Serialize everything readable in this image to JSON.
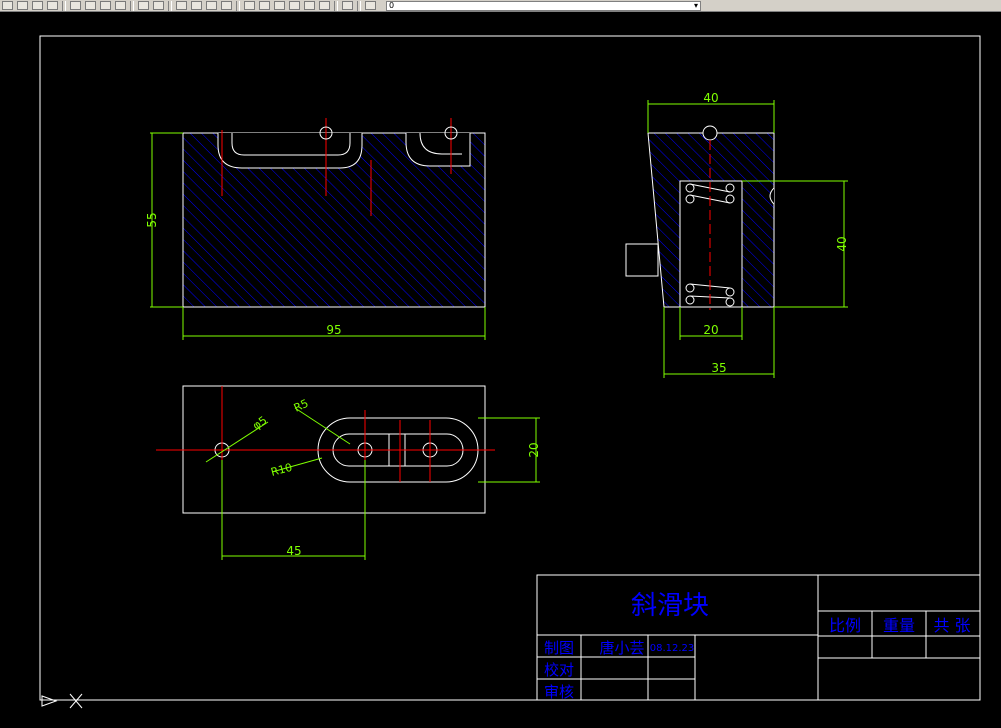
{
  "toolbar": {
    "layer_value": "0",
    "icons": [
      "open-icon",
      "save-icon",
      "print-icon",
      "preview-icon",
      "cut-icon",
      "copy-icon",
      "paste-icon",
      "matchprop-icon",
      "undo-icon",
      "redo-icon",
      "pan-icon",
      "zoom-realtime-icon",
      "zoom-window-icon",
      "zoom-previous-icon",
      "properties-icon",
      "designcenter-icon",
      "toolpalettes-icon",
      "sheetset-icon",
      "markup-icon",
      "calculator-icon",
      "help-icon",
      "layer-manager-icon"
    ]
  },
  "dims": {
    "front_height": "55",
    "front_width": "95",
    "side_top": "40",
    "side_right": "40",
    "side_inner": "20",
    "side_bottom": "35",
    "top_height": "20",
    "top_dist": "45",
    "r5": "R5",
    "r10": "R10",
    "d5": "φ5"
  },
  "title_block": {
    "part_name": "斜滑块",
    "scale_label": "比例",
    "weight_label": "重量",
    "sheets_label": "共 张",
    "drawn_label": "制图",
    "drawn_by": "唐小芸",
    "drawn_date": "08.12.23",
    "checked_label": "校对",
    "approved_label": "审核"
  },
  "colors": {
    "outline": "#ffffff",
    "dimension": "#7fff00",
    "centerline": "#ff0000",
    "hatch": "#0000ff",
    "title_text": "#0000ff",
    "canvas": "#000000"
  }
}
